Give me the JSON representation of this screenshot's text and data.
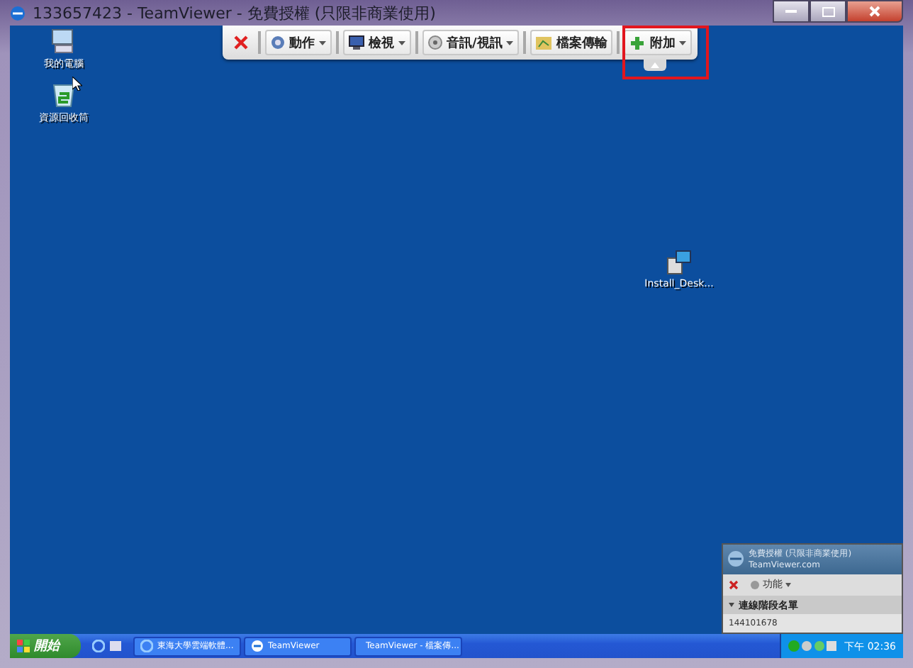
{
  "window": {
    "title": "133657423 - TeamViewer - 免費授權 (只限非商業使用)"
  },
  "toolbar": {
    "items": [
      {
        "kind": "close",
        "highlighted": false
      },
      {
        "kind": "menu",
        "label": "動作",
        "highlighted": false
      },
      {
        "kind": "menu",
        "label": "檢視",
        "highlighted": false
      },
      {
        "kind": "menu",
        "label": "音訊/視訊",
        "highlighted": false
      },
      {
        "kind": "button",
        "label": "檔案傳輸",
        "highlighted": false
      },
      {
        "kind": "menu",
        "label": "附加",
        "highlighted": true
      }
    ]
  },
  "desktop_icons": [
    {
      "kind": "computer",
      "label": "我的電腦"
    },
    {
      "kind": "recycle",
      "label": "資源回收筒"
    },
    {
      "kind": "installer",
      "label": "Install_Desk..."
    }
  ],
  "session_panel": {
    "title": "免費授權 (只限非商業使用)",
    "subtitle": "TeamViewer.com",
    "function_label": "功能",
    "section": "連線階段名單",
    "entries": [
      "144101678"
    ]
  },
  "taskbar": {
    "start": "開始",
    "tasks": [
      {
        "kind": "browser",
        "label": "東海大學雲端軟體..."
      },
      {
        "kind": "teamviewer",
        "label": "TeamViewer"
      },
      {
        "kind": "teamviewer",
        "label": "TeamViewer - 檔案傳..."
      }
    ],
    "clock": "下午 02:36"
  }
}
